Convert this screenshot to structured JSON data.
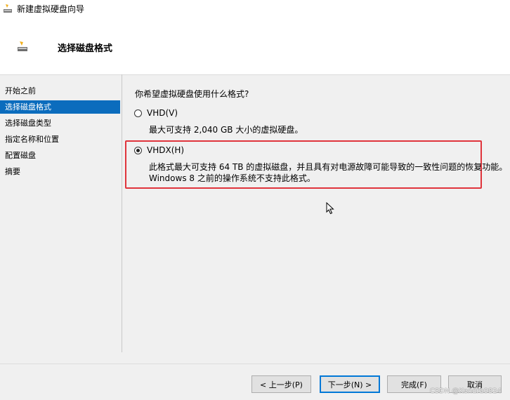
{
  "window": {
    "title": "新建虚拟硬盘向导"
  },
  "header": {
    "title": "选择磁盘格式"
  },
  "sidebar": {
    "items": [
      {
        "label": "开始之前",
        "active": false
      },
      {
        "label": "选择磁盘格式",
        "active": true
      },
      {
        "label": "选择磁盘类型",
        "active": false
      },
      {
        "label": "指定名称和位置",
        "active": false
      },
      {
        "label": "配置磁盘",
        "active": false
      },
      {
        "label": "摘要",
        "active": false
      }
    ]
  },
  "main": {
    "question": "你希望虚拟硬盘使用什么格式?",
    "options": [
      {
        "label": "VHD(V)",
        "checked": false,
        "desc": [
          "最大可支持 2,040 GB 大小的虚拟硬盘。"
        ]
      },
      {
        "label": "VHDX(H)",
        "checked": true,
        "desc": [
          "此格式最大可支持 64 TB 的虚拟磁盘，并且具有对电源故障可能导致的一致性问题的恢复功能。",
          "Windows 8 之前的操作系统不支持此格式。"
        ]
      }
    ]
  },
  "footer": {
    "prev_label": "< 上一步(P)",
    "next_label": "下一步(N) >",
    "finish_label": "完成(F)",
    "cancel_label": "取消"
  },
  "watermark": "CSDN @Kendra0824",
  "colors": {
    "selection": "#0b6cbd",
    "highlight_border": "#e0343c",
    "default_button_border": "#0078d7"
  }
}
